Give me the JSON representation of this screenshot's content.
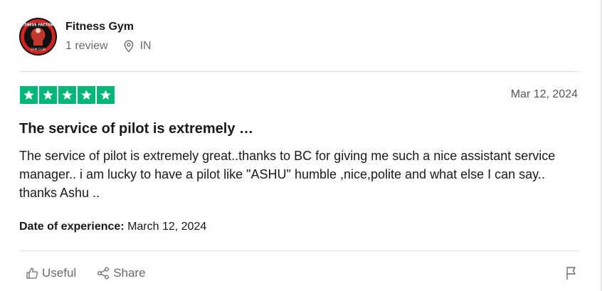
{
  "reviewer": {
    "name": "Fitness Gym",
    "reviews_count": "1 review",
    "country": "IN",
    "avatar_text_top": "FITNESS FACTORY",
    "avatar_text_bottom": "GYM CLUB",
    "icons": {
      "location": "location-pin-icon"
    }
  },
  "review": {
    "rating": 5,
    "rating_color": "#00b67a",
    "date_posted": "Mar 12, 2024",
    "title": "The service of pilot is extremely …",
    "body": "The service of pilot is extremely great..thanks to BC for giving me such a nice assistant service manager.. i am lucky to have a pilot like \"ASHU\" humble ,nice,polite and what else I can say.. thanks Ashu ..",
    "date_of_experience_label": "Date of experience:",
    "date_of_experience": "March 12, 2024"
  },
  "actions": {
    "useful_label": "Useful",
    "share_label": "Share",
    "icons": {
      "useful": "thumbs-up-icon",
      "share": "share-icon",
      "report": "flag-icon"
    }
  }
}
